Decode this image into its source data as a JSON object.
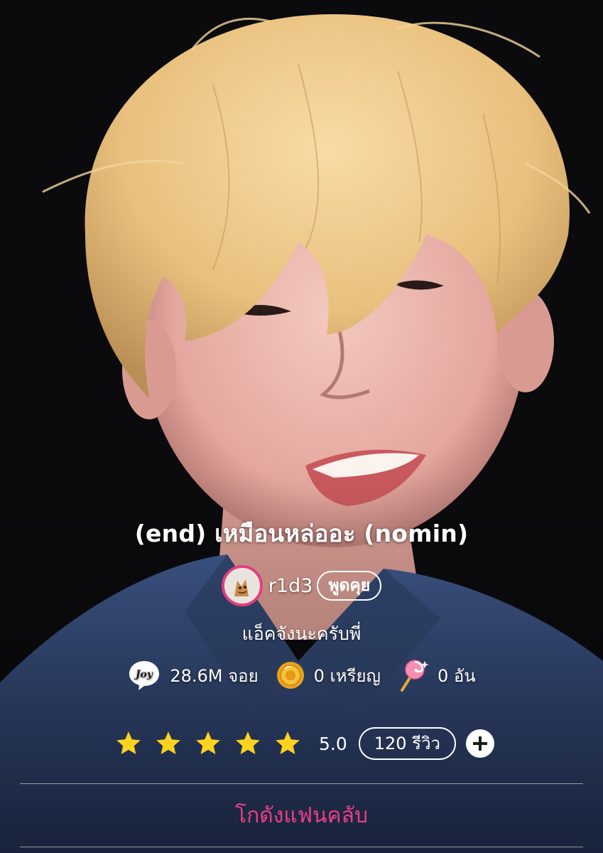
{
  "story": {
    "title": "(end) เหมือนหล่ออะ (nomin)",
    "subtitle": "แอ็คจังนะครับพี่"
  },
  "author": {
    "name": "r1d3",
    "chat_label": "พูดคุย",
    "avatar_icon": "cartoon-cat-avatar"
  },
  "stats": {
    "joy": {
      "icon": "joy-bubble-icon",
      "text": "28.6M จอย"
    },
    "coins": {
      "icon": "gold-coin-icon",
      "text": "0 เหรียญ"
    },
    "lollipops": {
      "icon": "lollipop-icon",
      "text": "0 อัน"
    }
  },
  "rating": {
    "stars": 5,
    "max_stars": 5,
    "value": "5.0",
    "review_label": "120 รีวิว",
    "add_icon": "plus-icon"
  },
  "fanclub": {
    "label": "โกดังแฟนคลับ"
  },
  "colors": {
    "accent_pink": "#e43d7f",
    "link_pink": "#ec3e86",
    "star_yellow": "#ffd21f",
    "background": "#0c0c0e"
  }
}
